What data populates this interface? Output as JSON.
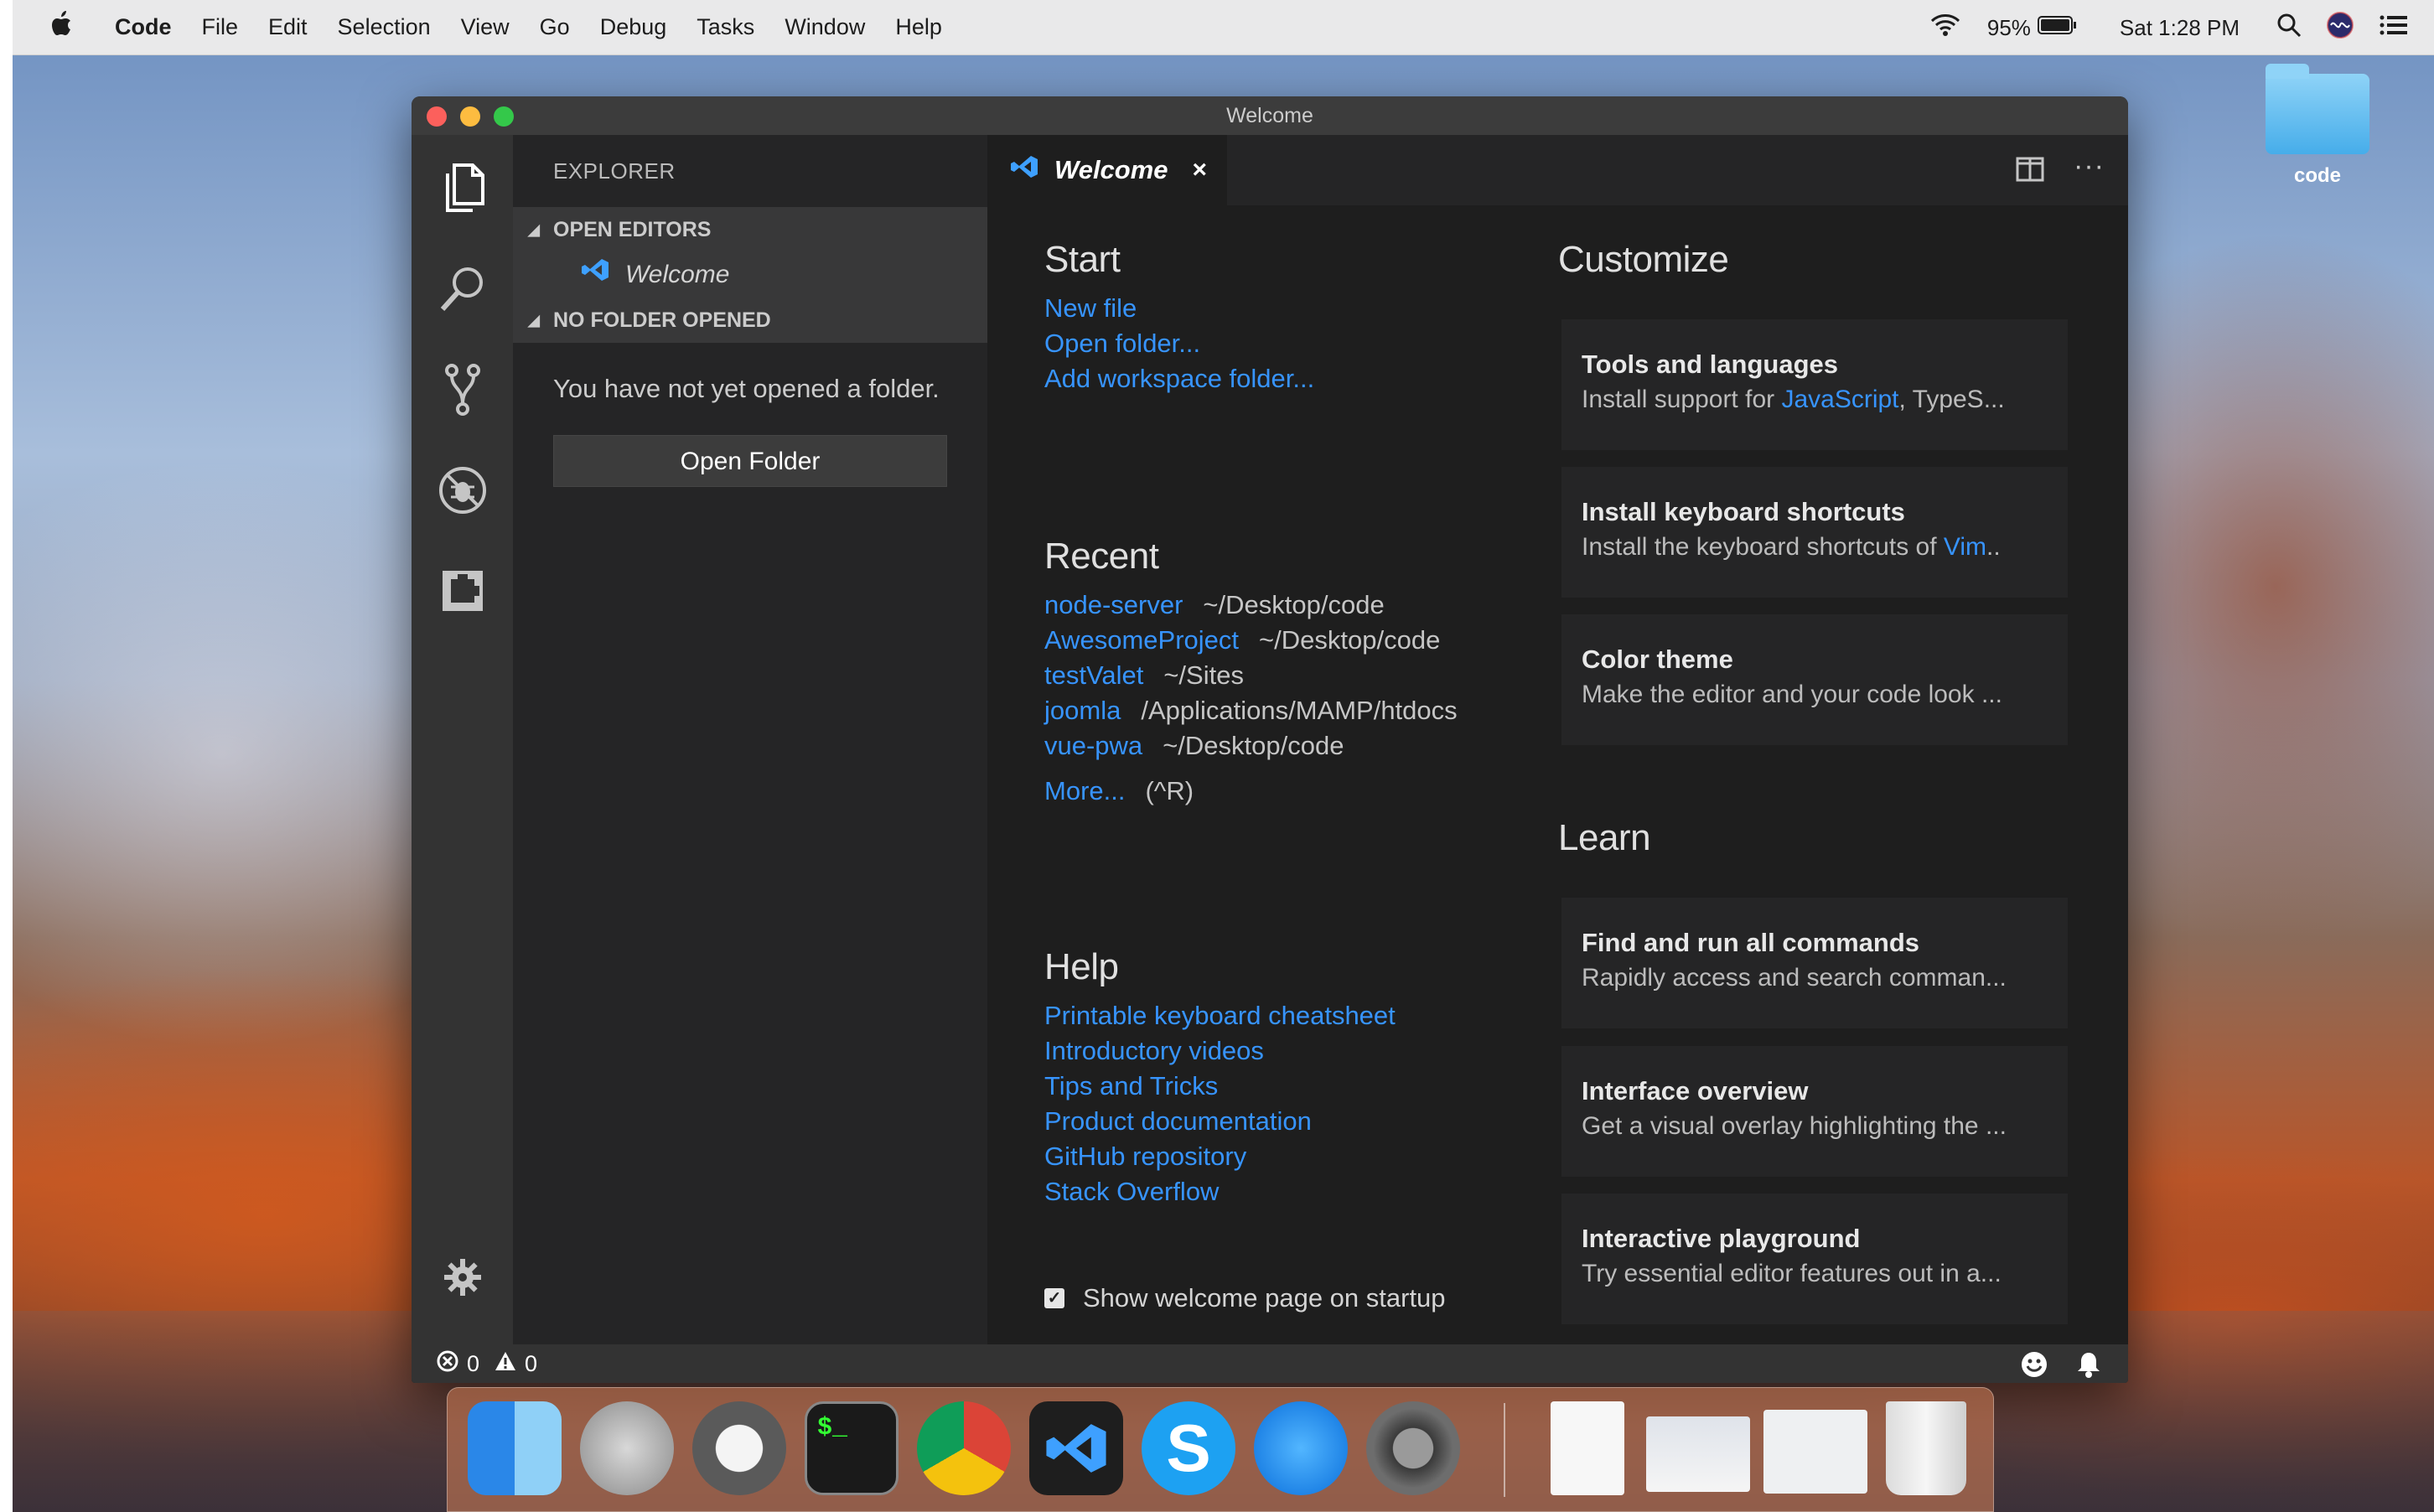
{
  "menubar": {
    "apple": "",
    "app": "Code",
    "items": [
      "File",
      "Edit",
      "Selection",
      "View",
      "Go",
      "Debug",
      "Tasks",
      "Window",
      "Help"
    ],
    "battery": "95%",
    "clock": "Sat 1:28 PM"
  },
  "desktop": {
    "folder_label": "code"
  },
  "window": {
    "title": "Welcome"
  },
  "sidebar": {
    "title": "EXPLORER",
    "open_editors": "OPEN EDITORS",
    "open_editor_item": "Welcome",
    "no_folder": "NO FOLDER OPENED",
    "message": "You have not yet opened a folder.",
    "open_folder_button": "Open Folder"
  },
  "tab": {
    "label": "Welcome",
    "close": "×"
  },
  "welcome": {
    "start": {
      "heading": "Start",
      "links": [
        "New file",
        "Open folder...",
        "Add workspace folder..."
      ]
    },
    "recent": {
      "heading": "Recent",
      "items": [
        {
          "name": "node-server",
          "path": "~/Desktop/code"
        },
        {
          "name": "AwesomeProject",
          "path": "~/Desktop/code"
        },
        {
          "name": "testValet",
          "path": "~/Sites"
        },
        {
          "name": "joomla",
          "path": "/Applications/MAMP/htdocs"
        },
        {
          "name": "vue-pwa",
          "path": "~/Desktop/code"
        }
      ],
      "more": "More...",
      "more_shortcut": "(^R)"
    },
    "help": {
      "heading": "Help",
      "links": [
        "Printable keyboard cheatsheet",
        "Introductory videos",
        "Tips and Tricks",
        "Product documentation",
        "GitHub repository",
        "Stack Overflow"
      ]
    },
    "customize": {
      "heading": "Customize",
      "cards": [
        {
          "title": "Tools and languages",
          "desc_pre": "Install support for ",
          "desc_hl": "JavaScript",
          "desc_post": ", TypeS..."
        },
        {
          "title": "Install keyboard shortcuts",
          "desc_pre": "Install the keyboard shortcuts of ",
          "desc_hl": "Vim",
          "desc_post": ".."
        },
        {
          "title": "Color theme",
          "desc_pre": "Make the editor and your code look ...",
          "desc_hl": "",
          "desc_post": ""
        }
      ]
    },
    "learn": {
      "heading": "Learn",
      "cards": [
        {
          "title": "Find and run all commands",
          "desc": "Rapidly access and search comman..."
        },
        {
          "title": "Interface overview",
          "desc": "Get a visual overlay highlighting the ..."
        },
        {
          "title": "Interactive playground",
          "desc": "Try essential editor features out in a..."
        }
      ]
    },
    "show_on_startup": "Show welcome page on startup"
  },
  "status": {
    "errors": "0",
    "warnings": "0"
  },
  "dock": [
    "Finder",
    "Launchpad",
    "Sequel Pro",
    "Terminal",
    "Chrome",
    "Visual Studio Code",
    "Skype",
    "App Store",
    "System Preferences",
    "XML document",
    "Screenshot",
    "MAMP document",
    "Trash"
  ],
  "colors": {
    "accent": "#3794ff",
    "editor_bg": "#1e1e1e",
    "sidebar_bg": "#252526",
    "activity_bg": "#333333"
  }
}
